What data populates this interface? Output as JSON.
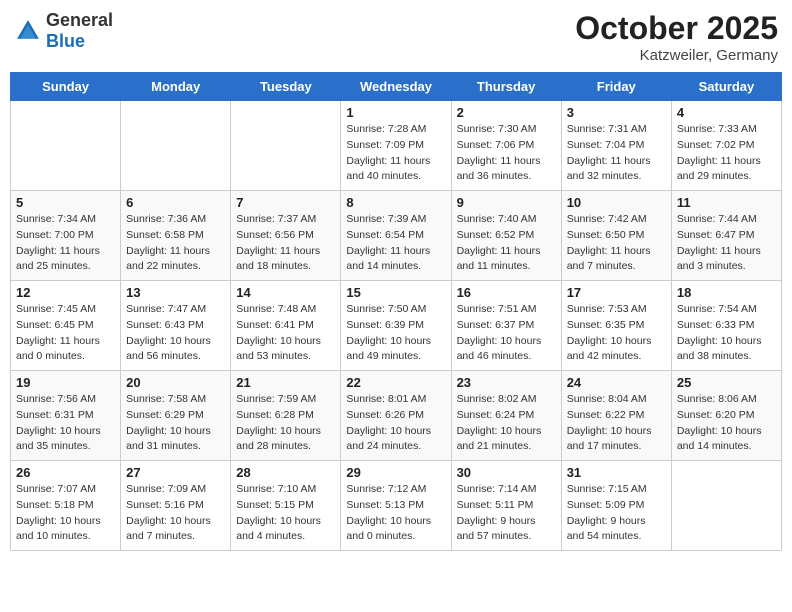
{
  "header": {
    "logo_general": "General",
    "logo_blue": "Blue",
    "month_title": "October 2025",
    "location": "Katzweiler, Germany"
  },
  "days_of_week": [
    "Sunday",
    "Monday",
    "Tuesday",
    "Wednesday",
    "Thursday",
    "Friday",
    "Saturday"
  ],
  "weeks": [
    [
      {
        "num": "",
        "sunrise": "",
        "sunset": "",
        "daylight": ""
      },
      {
        "num": "",
        "sunrise": "",
        "sunset": "",
        "daylight": ""
      },
      {
        "num": "",
        "sunrise": "",
        "sunset": "",
        "daylight": ""
      },
      {
        "num": "1",
        "sunrise": "Sunrise: 7:28 AM",
        "sunset": "Sunset: 7:09 PM",
        "daylight": "Daylight: 11 hours and 40 minutes."
      },
      {
        "num": "2",
        "sunrise": "Sunrise: 7:30 AM",
        "sunset": "Sunset: 7:06 PM",
        "daylight": "Daylight: 11 hours and 36 minutes."
      },
      {
        "num": "3",
        "sunrise": "Sunrise: 7:31 AM",
        "sunset": "Sunset: 7:04 PM",
        "daylight": "Daylight: 11 hours and 32 minutes."
      },
      {
        "num": "4",
        "sunrise": "Sunrise: 7:33 AM",
        "sunset": "Sunset: 7:02 PM",
        "daylight": "Daylight: 11 hours and 29 minutes."
      }
    ],
    [
      {
        "num": "5",
        "sunrise": "Sunrise: 7:34 AM",
        "sunset": "Sunset: 7:00 PM",
        "daylight": "Daylight: 11 hours and 25 minutes."
      },
      {
        "num": "6",
        "sunrise": "Sunrise: 7:36 AM",
        "sunset": "Sunset: 6:58 PM",
        "daylight": "Daylight: 11 hours and 22 minutes."
      },
      {
        "num": "7",
        "sunrise": "Sunrise: 7:37 AM",
        "sunset": "Sunset: 6:56 PM",
        "daylight": "Daylight: 11 hours and 18 minutes."
      },
      {
        "num": "8",
        "sunrise": "Sunrise: 7:39 AM",
        "sunset": "Sunset: 6:54 PM",
        "daylight": "Daylight: 11 hours and 14 minutes."
      },
      {
        "num": "9",
        "sunrise": "Sunrise: 7:40 AM",
        "sunset": "Sunset: 6:52 PM",
        "daylight": "Daylight: 11 hours and 11 minutes."
      },
      {
        "num": "10",
        "sunrise": "Sunrise: 7:42 AM",
        "sunset": "Sunset: 6:50 PM",
        "daylight": "Daylight: 11 hours and 7 minutes."
      },
      {
        "num": "11",
        "sunrise": "Sunrise: 7:44 AM",
        "sunset": "Sunset: 6:47 PM",
        "daylight": "Daylight: 11 hours and 3 minutes."
      }
    ],
    [
      {
        "num": "12",
        "sunrise": "Sunrise: 7:45 AM",
        "sunset": "Sunset: 6:45 PM",
        "daylight": "Daylight: 11 hours and 0 minutes."
      },
      {
        "num": "13",
        "sunrise": "Sunrise: 7:47 AM",
        "sunset": "Sunset: 6:43 PM",
        "daylight": "Daylight: 10 hours and 56 minutes."
      },
      {
        "num": "14",
        "sunrise": "Sunrise: 7:48 AM",
        "sunset": "Sunset: 6:41 PM",
        "daylight": "Daylight: 10 hours and 53 minutes."
      },
      {
        "num": "15",
        "sunrise": "Sunrise: 7:50 AM",
        "sunset": "Sunset: 6:39 PM",
        "daylight": "Daylight: 10 hours and 49 minutes."
      },
      {
        "num": "16",
        "sunrise": "Sunrise: 7:51 AM",
        "sunset": "Sunset: 6:37 PM",
        "daylight": "Daylight: 10 hours and 46 minutes."
      },
      {
        "num": "17",
        "sunrise": "Sunrise: 7:53 AM",
        "sunset": "Sunset: 6:35 PM",
        "daylight": "Daylight: 10 hours and 42 minutes."
      },
      {
        "num": "18",
        "sunrise": "Sunrise: 7:54 AM",
        "sunset": "Sunset: 6:33 PM",
        "daylight": "Daylight: 10 hours and 38 minutes."
      }
    ],
    [
      {
        "num": "19",
        "sunrise": "Sunrise: 7:56 AM",
        "sunset": "Sunset: 6:31 PM",
        "daylight": "Daylight: 10 hours and 35 minutes."
      },
      {
        "num": "20",
        "sunrise": "Sunrise: 7:58 AM",
        "sunset": "Sunset: 6:29 PM",
        "daylight": "Daylight: 10 hours and 31 minutes."
      },
      {
        "num": "21",
        "sunrise": "Sunrise: 7:59 AM",
        "sunset": "Sunset: 6:28 PM",
        "daylight": "Daylight: 10 hours and 28 minutes."
      },
      {
        "num": "22",
        "sunrise": "Sunrise: 8:01 AM",
        "sunset": "Sunset: 6:26 PM",
        "daylight": "Daylight: 10 hours and 24 minutes."
      },
      {
        "num": "23",
        "sunrise": "Sunrise: 8:02 AM",
        "sunset": "Sunset: 6:24 PM",
        "daylight": "Daylight: 10 hours and 21 minutes."
      },
      {
        "num": "24",
        "sunrise": "Sunrise: 8:04 AM",
        "sunset": "Sunset: 6:22 PM",
        "daylight": "Daylight: 10 hours and 17 minutes."
      },
      {
        "num": "25",
        "sunrise": "Sunrise: 8:06 AM",
        "sunset": "Sunset: 6:20 PM",
        "daylight": "Daylight: 10 hours and 14 minutes."
      }
    ],
    [
      {
        "num": "26",
        "sunrise": "Sunrise: 7:07 AM",
        "sunset": "Sunset: 5:18 PM",
        "daylight": "Daylight: 10 hours and 10 minutes."
      },
      {
        "num": "27",
        "sunrise": "Sunrise: 7:09 AM",
        "sunset": "Sunset: 5:16 PM",
        "daylight": "Daylight: 10 hours and 7 minutes."
      },
      {
        "num": "28",
        "sunrise": "Sunrise: 7:10 AM",
        "sunset": "Sunset: 5:15 PM",
        "daylight": "Daylight: 10 hours and 4 minutes."
      },
      {
        "num": "29",
        "sunrise": "Sunrise: 7:12 AM",
        "sunset": "Sunset: 5:13 PM",
        "daylight": "Daylight: 10 hours and 0 minutes."
      },
      {
        "num": "30",
        "sunrise": "Sunrise: 7:14 AM",
        "sunset": "Sunset: 5:11 PM",
        "daylight": "Daylight: 9 hours and 57 minutes."
      },
      {
        "num": "31",
        "sunrise": "Sunrise: 7:15 AM",
        "sunset": "Sunset: 5:09 PM",
        "daylight": "Daylight: 9 hours and 54 minutes."
      },
      {
        "num": "",
        "sunrise": "",
        "sunset": "",
        "daylight": ""
      }
    ]
  ]
}
